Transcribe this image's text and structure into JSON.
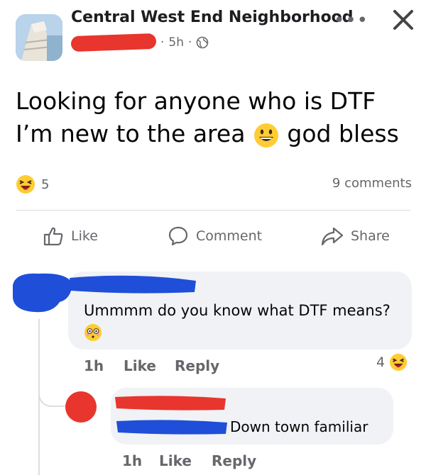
{
  "post": {
    "group_name": "Central West End Neighborhood",
    "time": "5h",
    "separator": "·",
    "text_part1": "Looking for anyone who is DTF I’m new to the area",
    "text_part2": "god bless",
    "reaction_count": "5",
    "comments_count": "9 comments"
  },
  "actions": {
    "like": "Like",
    "comment": "Comment",
    "share": "Share"
  },
  "comments": [
    {
      "text": "Ummmm do you know what DTF means?",
      "time": "1h",
      "like": "Like",
      "reply": "Reply",
      "reaction_count": "4"
    }
  ],
  "reply": {
    "text": "Down town familiar",
    "time": "1h",
    "like": "Like",
    "reply": "Reply"
  },
  "icons": [
    "group-avatar",
    "more-icon",
    "close-icon",
    "globe-icon",
    "grinning-emoji",
    "laughing-emoji",
    "like-icon",
    "comment-icon",
    "share-icon",
    "flushed-emoji"
  ],
  "colors": {
    "redaction_red": "#e8352d",
    "redaction_blue": "#1f4fd8",
    "bubble": "#f0f2f5",
    "meta_text": "#65676b"
  }
}
